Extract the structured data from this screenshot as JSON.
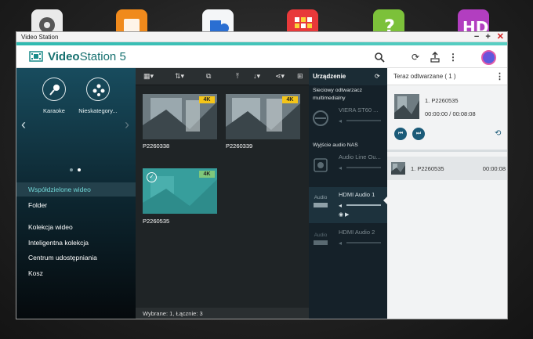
{
  "window": {
    "title": "Video Station"
  },
  "app": {
    "name_prefix": "Video",
    "name_suffix": "Station 5"
  },
  "categories": [
    {
      "label": "Karaoke"
    },
    {
      "label": "Nieskategory..."
    }
  ],
  "nav": [
    {
      "label": "Współdzielone wideo",
      "selected": true
    },
    {
      "label": "Folder"
    },
    {
      "label": "Kolekcja wideo"
    },
    {
      "label": "Inteligentna kolekcja"
    },
    {
      "label": "Centrum udostępniania"
    },
    {
      "label": "Kosz"
    }
  ],
  "videos": [
    {
      "name": "P2260338",
      "badge": "4K",
      "selected": false
    },
    {
      "name": "P2260339",
      "badge": "4K",
      "selected": false
    },
    {
      "name": "P2260535",
      "badge": "4K",
      "selected": true
    }
  ],
  "status": {
    "text": "Wybrane: 1, Łącznie: 3"
  },
  "devices": {
    "title": "Urządzenie",
    "section_media": "Sieciowy odtwarzacz multimedialny",
    "section_nas": "Wyjście audio NAS",
    "items": [
      {
        "name": "VIERA ST60 ...",
        "icon_text": ""
      },
      {
        "name": "Audio Line Ou...",
        "icon_text": ""
      },
      {
        "name": "HDMI Audio 1",
        "icon_text": "Audio",
        "active": true
      },
      {
        "name": "HDMI Audio 2",
        "icon_text": "Audio"
      }
    ]
  },
  "now_playing": {
    "title": "Teraz odtwarzane ( 1 )",
    "track": "1. P2260535",
    "time": "00:00:00 / 00:08:08",
    "progress": 0,
    "queue": [
      {
        "name": "1. P2260535",
        "duration": "00:00:08"
      }
    ]
  },
  "colors": {
    "accent": "#2fb9b0",
    "selected_nav_text": "#6fd6d6",
    "badge": "#f5c518"
  }
}
